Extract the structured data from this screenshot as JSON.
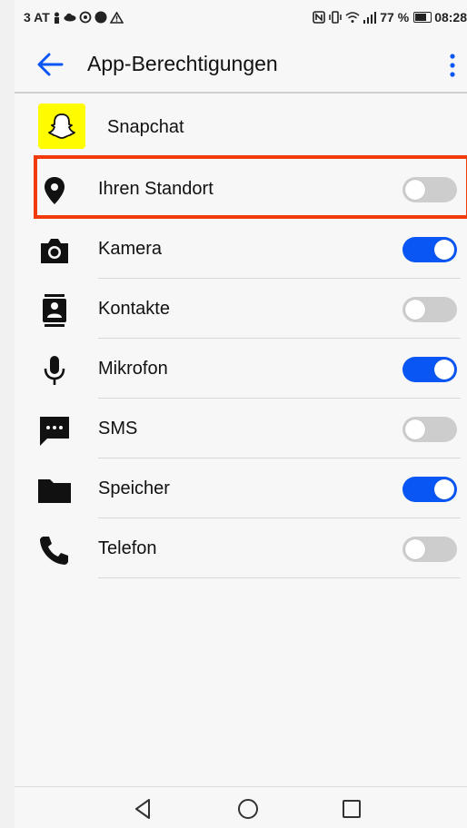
{
  "status_bar": {
    "left_text": "3 AT",
    "battery_percent": "77 %",
    "time": "08:28"
  },
  "app_bar": {
    "title": "App-Berechtigungen"
  },
  "app": {
    "name": "Snapchat",
    "icon": "snapchat-ghost-icon",
    "icon_color": "#fffc00"
  },
  "permissions": [
    {
      "label": "Ihren Standort",
      "icon": "location-pin-icon",
      "enabled": false
    },
    {
      "label": "Kamera",
      "icon": "camera-icon",
      "enabled": true
    },
    {
      "label": "Kontakte",
      "icon": "contacts-icon",
      "enabled": false
    },
    {
      "label": "Mikrofon",
      "icon": "microphone-icon",
      "enabled": true
    },
    {
      "label": "SMS",
      "icon": "sms-icon",
      "enabled": false
    },
    {
      "label": "Speicher",
      "icon": "folder-icon",
      "enabled": true
    },
    {
      "label": "Telefon",
      "icon": "phone-icon",
      "enabled": false
    }
  ],
  "colors": {
    "accent": "#0a56f5",
    "highlight": "#f23b0a",
    "toggle_off": "#cdcdcd"
  },
  "nav_bar": [
    "back-triangle-icon",
    "home-circle-icon",
    "recents-square-icon"
  ]
}
